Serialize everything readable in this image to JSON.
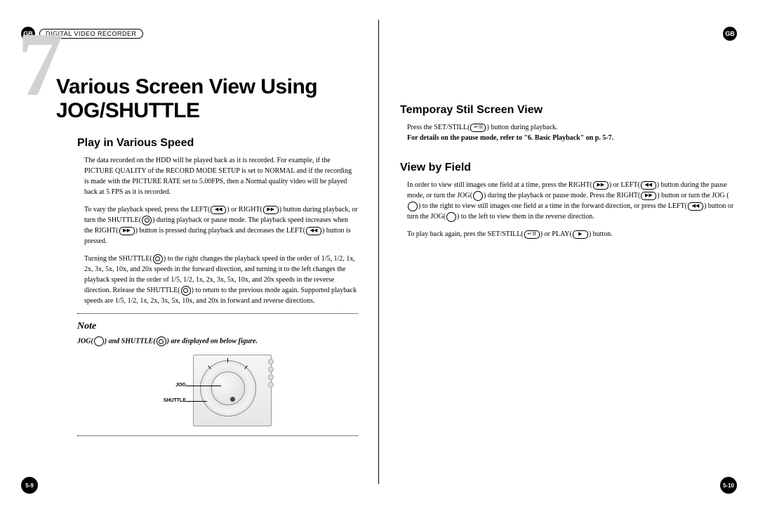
{
  "header": {
    "gb_label": "GB",
    "pill_label": "DIGITAL VIDEO RECORDER"
  },
  "chapter": {
    "number": "7",
    "title": "Various Screen View Using JOG/SHUTTLE"
  },
  "left": {
    "section1_title": "Play in Various Speed",
    "para1": "The data recorded on the HDD will be played back as it is recorded. For example, if the PICTURE QUALITY of the RECORD MODE SETUP is set to NORMAL and if the recording is made with the PICTURE RATE set to 5.00FPS, then a Normal quality video will be played back at 5 FPS as it is recorded.",
    "para2_a": "To vary the playback speed, press the LEFT(",
    "para2_b": ") or RIGHT(",
    "para2_c": ") button during playback, or turn the SHUTTLE(",
    "para2_d": ") during playback or pause mode. The playback speed increases when the RIGHT(",
    "para2_e": ") button is pressed during playback and decreases the LEFT(",
    "para2_f": ") button is pressed.",
    "para3_a": "Turning the SHUTTLE(",
    "para3_b": ") to the right changes the playback speed in the order of 1/5, 1/2, 1x, 2x, 3x, 5x, 10x, and 20x speeds in the forward direction, and turning it to the left changes the playback speed in the order of 1/5, 1/2, 1x, 2x, 3x, 5x, 10x, and 20x speeds in the reverse direction. Release the SHUTTLE(",
    "para3_c": ") to return to the previous mode again. Supported playback speeds are 1/5, 1/2, 1x, 2x, 3x, 5x, 10x, and 20x in forward and reverse directions.",
    "note_label": "Note",
    "note_a": "JOG(",
    "note_b": ") and SHUTTLE(",
    "note_c": ") are displayed on below figure.",
    "figure": {
      "jog_label": "JOG",
      "shuttle_label": "SHUTTLE"
    }
  },
  "right": {
    "section1_title": "Temporay Stil Screen View",
    "sec1_a": "Press the SET/STILL(",
    "sec1_b": ") button during playback.",
    "sec1_bold": "For details on the pause mode, refer to \"6. Basic Playback\" on p. 5-7.",
    "section2_title": "View by Field",
    "sec2_a": "In order to view still images one field at a time, press the RIGHT(",
    "sec2_b": ") or LEFT(",
    "sec2_c": ") button during the pause mode, or turn the JOG(",
    "sec2_d": ") during the playback or pause mode. Press the RIGHT(",
    "sec2_e": ") button or turn the JOG (",
    "sec2_f": ") to the right to view still images one field at a time in the forward direction, or press the LEFT(",
    "sec2_g": ") button or turn the JOG(",
    "sec2_h": ") to the left to view them in the reverse direction.",
    "sec2_i": "To play back again, pres the SET/STILL(",
    "sec2_j": ") or PLAY(",
    "sec2_k": ") button."
  },
  "page_numbers": {
    "left": "5-9",
    "right": "5-10"
  },
  "icons": {
    "rewind": "◀◀",
    "fforward": "▶▶",
    "play": "▶",
    "setstill": "↵/II"
  }
}
